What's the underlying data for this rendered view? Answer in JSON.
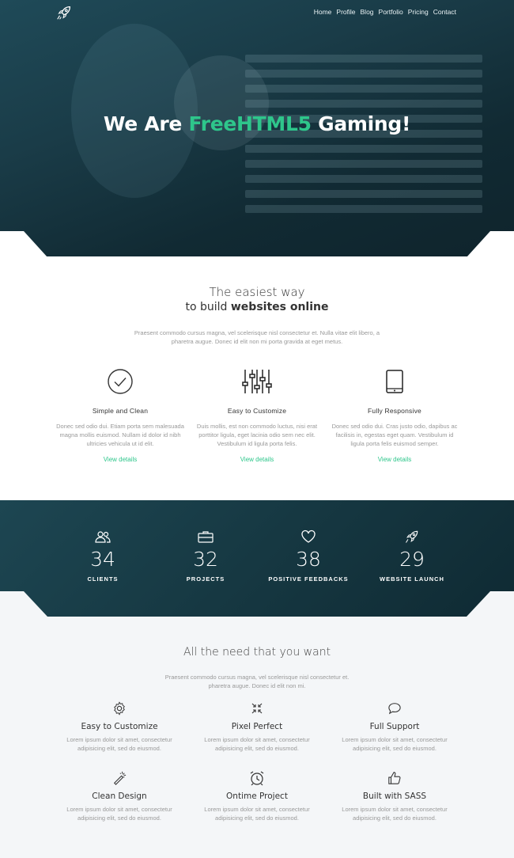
{
  "nav": {
    "items": [
      "Home",
      "Profile",
      "Blog",
      "Portfolio",
      "Pricing",
      "Contact"
    ]
  },
  "hero": {
    "title_prefix": "We Are",
    "title_accent": "FreeHTML5",
    "title_suffix": "Gaming!"
  },
  "intro": {
    "title": "The easiest way",
    "subtitle_prefix": "to build",
    "subtitle_bold": "websites online",
    "description": "Praesent commodo cursus magna, vel scelerisque nisl consectetur et. Nulla vitae elit libero, a pharetra augue. Donec id elit non mi porta gravida at eget metus."
  },
  "features": [
    {
      "icon": "check-circle-icon",
      "title": "Simple and Clean",
      "desc": "Donec sed odio dui. Etiam porta sem malesuada magna mollis euismod. Nullam id dolor id nibh ultricies vehicula ut id elit.",
      "link": "View details"
    },
    {
      "icon": "sliders-icon",
      "title": "Easy to Customize",
      "desc": "Duis mollis, est non commodo luctus, nisi erat porttitor ligula, eget lacinia odio sem nec elit. Vestibulum id ligula porta felis.",
      "link": "View details"
    },
    {
      "icon": "tablet-icon",
      "title": "Fully Responsive",
      "desc": "Donec sed odio dui. Cras justo odio, dapibus ac facilisis in, egestas eget quam. Vestibulum id ligula porta felis euismod semper.",
      "link": "View details"
    }
  ],
  "counters": [
    {
      "icon": "users-icon",
      "number": "34",
      "label": "CLIENTS"
    },
    {
      "icon": "briefcase-icon",
      "number": "32",
      "label": "PROJECTS"
    },
    {
      "icon": "heart-icon",
      "number": "38",
      "label": "POSITIVE FEEDBACKS"
    },
    {
      "icon": "rocket-icon",
      "number": "29",
      "label": "WEBSITE LAUNCH"
    }
  ],
  "services": {
    "title": "All the need that you want",
    "description": "Praesent commodo cursus magna, vel scelerisque nisl consectetur et. pharetra augue. Donec id elit non mi.",
    "items": [
      {
        "icon": "gear-icon",
        "title": "Easy to Customize",
        "desc": "Lorem ipsum dolor sit amet, consectetur adipisicing elit, sed do eiusmod."
      },
      {
        "icon": "arrows-in-icon",
        "title": "Pixel Perfect",
        "desc": "Lorem ipsum dolor sit amet, consectetur adipisicing elit, sed do eiusmod."
      },
      {
        "icon": "chat-icon",
        "title": "Full Support",
        "desc": "Lorem ipsum dolor sit amet, consectetur adipisicing elit, sed do eiusmod."
      },
      {
        "icon": "magic-wand-icon",
        "title": "Clean Design",
        "desc": "Lorem ipsum dolor sit amet, consectetur adipisicing elit, sed do eiusmod."
      },
      {
        "icon": "alarm-clock-icon",
        "title": "Ontime Project",
        "desc": "Lorem ipsum dolor sit amet, consectetur adipisicing elit, sed do eiusmod."
      },
      {
        "icon": "thumbs-up-icon",
        "title": "Built with SASS",
        "desc": "Lorem ipsum dolor sit amet, consectetur adipisicing elit, sed do eiusmod."
      }
    ]
  },
  "colors": {
    "accent": "#2ec68b",
    "hero_bg": "#1a3c48",
    "services_bg": "#f4f6f8"
  }
}
